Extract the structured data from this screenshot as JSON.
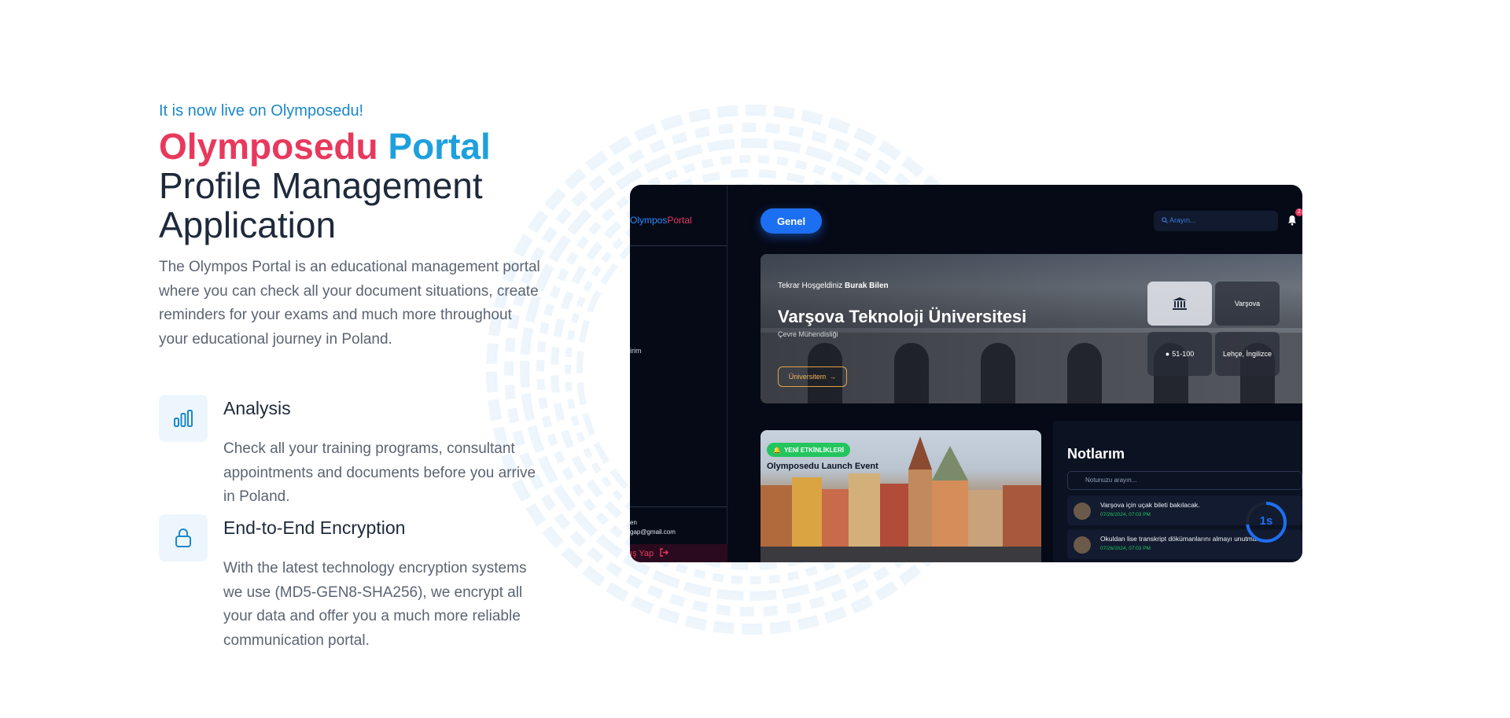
{
  "eyebrow": "It is now live on Olymposedu!",
  "title": {
    "part1": "Olymposedu",
    "part2": "Portal",
    "line2": "Profile Management",
    "line3": "Application"
  },
  "intro": "The Olympos Portal is an educational management portal where you can check all your document situations, create reminders for your exams and much more throughout your educational journey in Poland.",
  "features": [
    {
      "icon": "bar-chart-icon",
      "title": "Analysis",
      "description": "Check all your training programs, consultant appointments and documents before you arrive in Poland."
    },
    {
      "icon": "lock-icon",
      "title": "End-to-End Encryption",
      "description": "With the latest technology encryption systems we use (MD5-GEN8-SHA256), we encrypt all your data and offer you a much more reliable communication portal."
    }
  ],
  "colors": {
    "accent_red": "#e8395d",
    "accent_blue": "#1ea0dd",
    "app_bg": "#060a17",
    "primary_button": "#1d6ff2",
    "success": "#22c55e"
  },
  "app": {
    "brand": {
      "part1": "Olympos",
      "part2": "Portal"
    },
    "sidebar": {
      "item": "irim",
      "user_name": "en",
      "user_email": "gap@gmail.com",
      "logout": "ış Yap"
    },
    "header": {
      "tab": "Genel",
      "search_placeholder": "Arayın...",
      "notification_count": "2"
    },
    "hero": {
      "welcome_prefix": "Tekrar Hoşgeldiniz",
      "user": "Burak Bilen",
      "university": "Varşova Teknoloji Üniversitesi",
      "department": "Çevre Mühendisliği",
      "button": "Üniversitem",
      "tiles": {
        "city": "Varşova",
        "ranking": "51-100",
        "languages": "Lehçe, İngilizce"
      }
    },
    "event": {
      "badge": "YENİ ETKİNLİKLERİ",
      "title": "Olymposedu Launch Event"
    },
    "notes": {
      "title": "Notlarım",
      "search_placeholder": "Notunuzu arayın...",
      "items": [
        {
          "text": "Varşova için uçak bileti bakılacak.",
          "date": "07/26/2024, 07:03 PM"
        },
        {
          "text": "Okuldan lise transkript dökümanlarını almayı unutma.",
          "date": "07/26/2024, 07:03 PM"
        }
      ],
      "timer": "1s"
    }
  }
}
